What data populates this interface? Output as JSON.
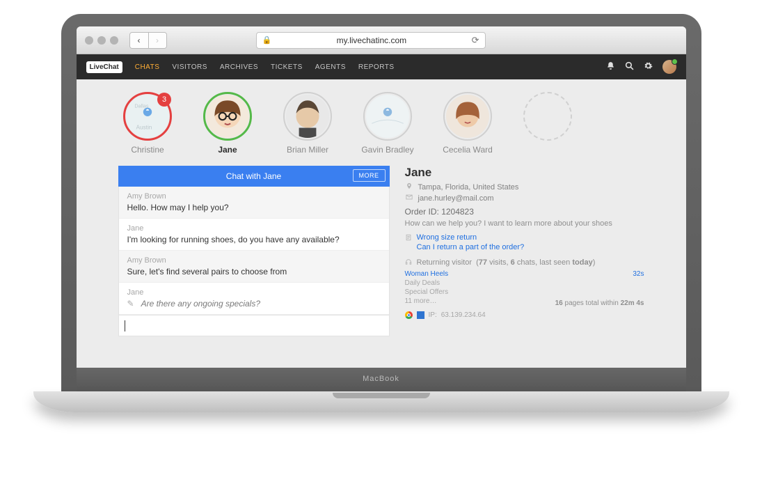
{
  "browser": {
    "url": "my.livechatinc.com"
  },
  "nav": {
    "logo": "LiveChat",
    "items": [
      "CHATS",
      "VISITORS",
      "ARCHIVES",
      "TICKETS",
      "AGENTS",
      "REPORTS"
    ],
    "active_index": 0
  },
  "visitors": [
    {
      "name": "Christine",
      "ring": "red",
      "badge": "3",
      "bold": false,
      "type": "map"
    },
    {
      "name": "Jane",
      "ring": "green",
      "badge": null,
      "bold": true,
      "type": "woman-glasses"
    },
    {
      "name": "Brian Miller",
      "ring": "gray",
      "badge": null,
      "bold": false,
      "type": "man"
    },
    {
      "name": "Gavin Bradley",
      "ring": "gray",
      "badge": null,
      "bold": false,
      "type": "map"
    },
    {
      "name": "Cecelia Ward",
      "ring": "gray",
      "badge": null,
      "bold": false,
      "type": "woman"
    },
    {
      "name": "",
      "ring": "dashed",
      "badge": null,
      "bold": false,
      "type": "empty"
    }
  ],
  "chat": {
    "header": "Chat with Jane",
    "more": "MORE",
    "messages": [
      {
        "author": "Amy Brown",
        "text": "Hello. How may I help you?",
        "gray": true
      },
      {
        "author": "Jane",
        "text": "I'm looking for running shoes, do you have any available?",
        "gray": false
      },
      {
        "author": "Amy Brown",
        "text": "Sure, let's find several pairs to choose from",
        "gray": true
      }
    ],
    "typing": {
      "author": "Jane",
      "text": "Are there any ongoing specials?"
    }
  },
  "details": {
    "name": "Jane",
    "location": "Tampa, Florida, United States",
    "email": "jane.hurley@mail.com",
    "order_label": "Order ID:",
    "order_id": "1204823",
    "question": "How can we help you? I want to learn more about your shoes",
    "help_links": [
      "Wrong size return",
      "Can I return a part of the order?"
    ],
    "visitor_status": "Returning visitor",
    "visit_summary_parts": {
      "prefix": "(",
      "visits_n": "77",
      "visits_w": "visits,",
      "chats_n": "6",
      "chats_w": "chats, last seen",
      "today": "today",
      "suffix": ")"
    },
    "pages": [
      {
        "title": "Woman Heels",
        "time": "32s"
      },
      {
        "title": "Daily Deals",
        "time": ""
      },
      {
        "title": "Special Offers",
        "time": ""
      }
    ],
    "more_pages": "11 more…",
    "pages_total_parts": {
      "n": "16",
      "mid": "pages total within",
      "dur": "22m 4s"
    },
    "ip_label": "IP:",
    "ip": "63.139.234.64"
  },
  "device_brand": "MacBook"
}
